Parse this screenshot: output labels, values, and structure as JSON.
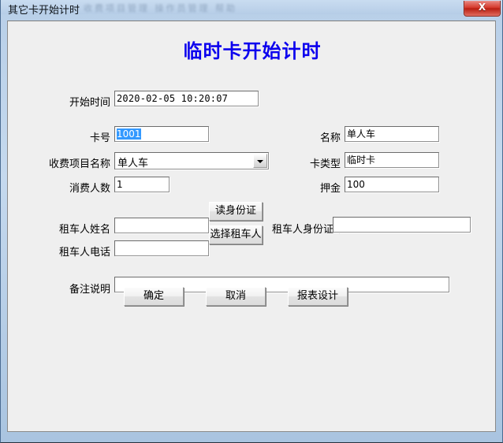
{
  "window": {
    "title": "其它卡开始计时",
    "ghost_background_text": "收费项目管理   操作员管理   帮助",
    "close_label": "X",
    "close_icon": "close-icon"
  },
  "dialog": {
    "heading": "临时卡开始计时",
    "heading_color": "#0c00ee"
  },
  "fields": {
    "start_time": {
      "label": "开始时间",
      "value": "2020-02-05 10:20:07"
    },
    "card_number": {
      "label": "卡号",
      "value": "1001",
      "selected": true
    },
    "name": {
      "label": "名称",
      "value": "单人车"
    },
    "charge_item": {
      "label": "收费项目名称",
      "value": "单人车",
      "options": [
        "单人车"
      ],
      "arrow_icon": "chevron-down-icon"
    },
    "card_type": {
      "label": "卡类型",
      "value": "临时卡"
    },
    "person_count": {
      "label": "消费人数",
      "value": "1"
    },
    "deposit": {
      "label": "押金",
      "value": "100"
    },
    "renter_name": {
      "label": "租车人姓名",
      "value": ""
    },
    "renter_id_number": {
      "label": "租车人身份证号",
      "value": ""
    },
    "renter_phone": {
      "label": "租车人电话",
      "value": ""
    },
    "remark": {
      "label": "备注说明",
      "value": ""
    }
  },
  "buttons": {
    "read_id_card": "读身份证",
    "select_renter": "选择租车人",
    "confirm": "确定",
    "cancel": "取消",
    "report_design": "报表设计"
  }
}
